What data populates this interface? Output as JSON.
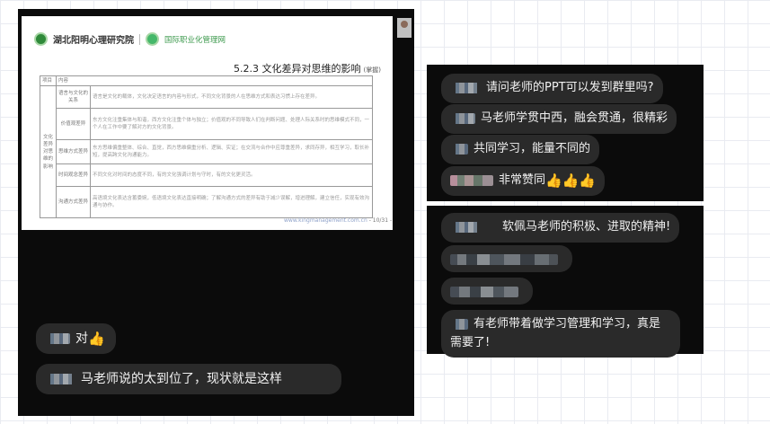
{
  "slide": {
    "logo_left": "湖北阳明心理研究院",
    "logo_right": "国际职业化管理网",
    "title": "5.2.3 文化差异对思维的影响",
    "title_note": "(掌握)",
    "table": {
      "head_left": "项目",
      "head_right": "内容",
      "category": "文化差异对思维的影响",
      "rows": [
        {
          "label": "语言与文化的关系",
          "text": "语言是文化的载体，文化决定语言的内容与形式，不同文化背景的人在思维方式和表达习惯上存在差异。"
        },
        {
          "label": "价值观差异",
          "text": "东方文化注重集体与和谐，西方文化注重个体与独立；价值观的不同导致人们在判断问题、处理人际关系时的思维模式不同，一个人在工作中要了解对方的文化背景。"
        },
        {
          "label": "思维方式差异",
          "text": "东方思维偏重整体、综合、直觉，西方思维偏重分析、逻辑、实证；在交流与合作中应尊重差异，求同存异，相互学习，取长补短，提高跨文化沟通能力。"
        },
        {
          "label": "时间观念差异",
          "text": "不同文化对时间的态度不同，有的文化强调计划与守时，有的文化更灵活。"
        },
        {
          "label": "沟通方式差异",
          "text": "高语境文化表达含蓄委婉，低语境文化表达直接明确；了解沟通方式的差异有助于减少误解，增进理解，建立信任，实现有效沟通与协作。"
        }
      ]
    },
    "footer_url": "www.kingmanagement.com.cn",
    "footer_page": "- 10/31 -"
  },
  "left_chat": [
    {
      "text": "对",
      "emoji": "👍"
    },
    {
      "text": "马老师说的太到位了，现状就是这样",
      "emoji": ""
    }
  ],
  "right_top_chat": [
    {
      "text": "请问老师的PPT可以发到群里吗?",
      "emoji": ""
    },
    {
      "text": "马老师学贯中西，融会贯通，很精彩",
      "emoji": ""
    },
    {
      "text": "共同学习，能量不同的",
      "emoji": ""
    },
    {
      "text": "非常赞同",
      "emoji": "👍👍👍"
    }
  ],
  "right_bottom_chat": [
    {
      "text": "软佩马老师的积极、进取的精神!",
      "emoji": ""
    },
    {
      "text": "",
      "emoji": ""
    },
    {
      "text": "",
      "emoji": ""
    },
    {
      "text": "有老师带着做学习管理和学习，真是需要了!",
      "emoji": ""
    }
  ]
}
